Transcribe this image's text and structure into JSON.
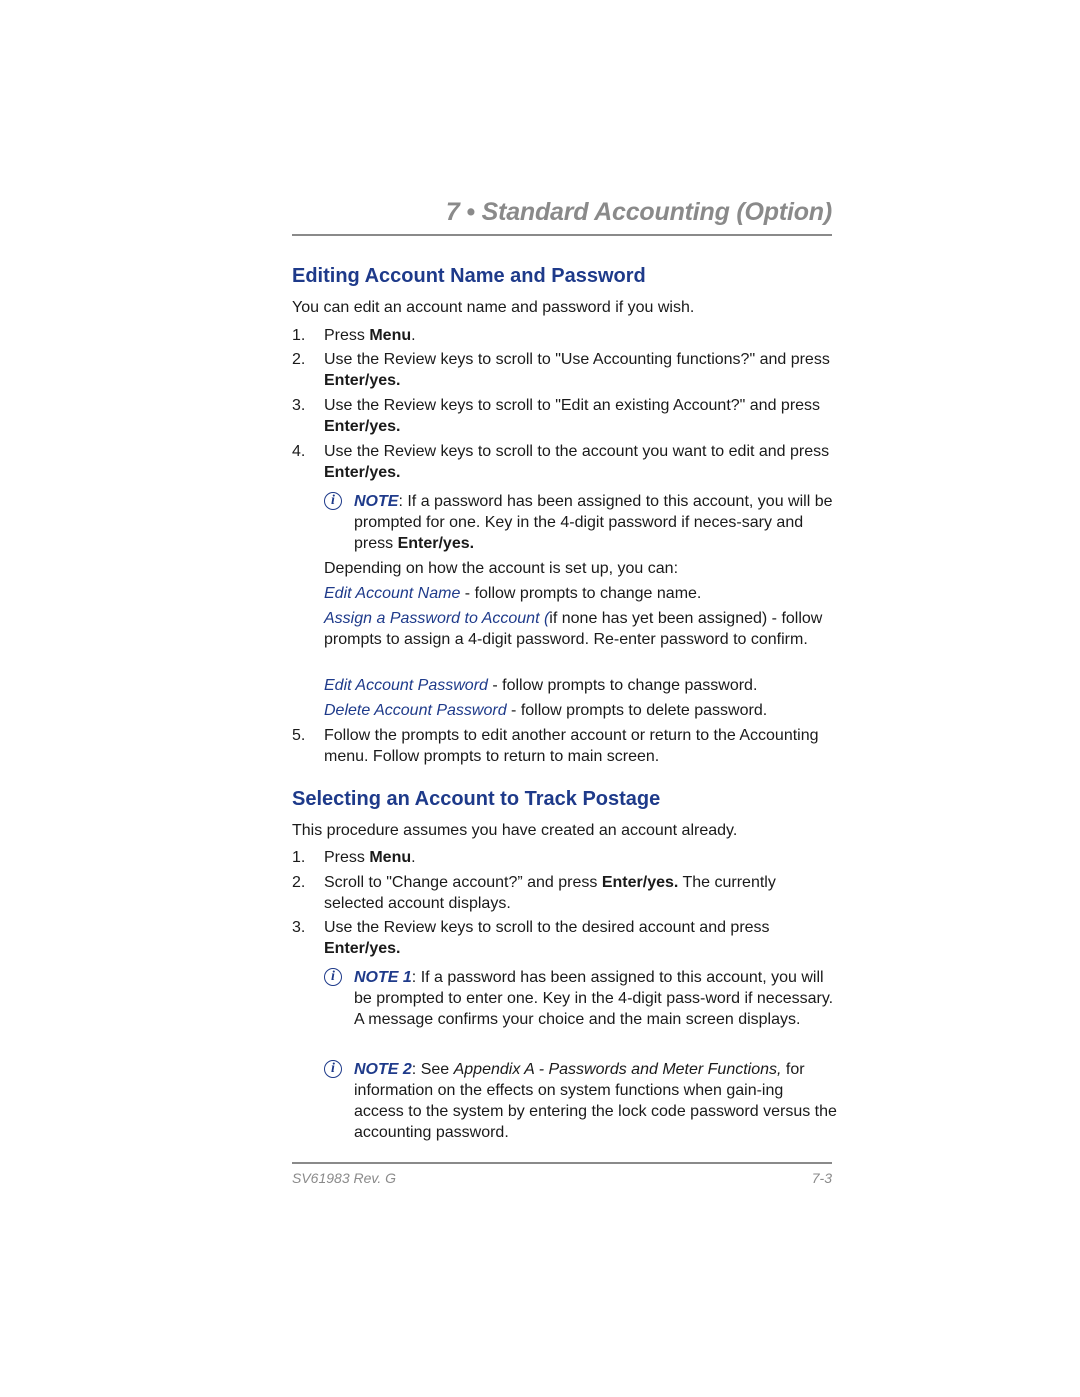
{
  "header": {
    "chapter_title": "7 • Standard Accounting (Option)"
  },
  "section1": {
    "heading": "Editing Account Name and Password",
    "intro": "You can edit an account name and password if you wish.",
    "steps": [
      {
        "num": "1.",
        "pre": "Press ",
        "bold": "Menu",
        "post": "."
      },
      {
        "num": "2.",
        "pre": "Use the Review keys to scroll to \"Use Accounting functions?\" and press ",
        "bold": "Enter/yes.",
        "post": ""
      },
      {
        "num": "3.",
        "pre": "Use the Review keys to scroll to \"Edit an existing Account?\" and press ",
        "bold": "Enter/yes.",
        "post": ""
      },
      {
        "num": "4.",
        "pre": "Use the Review keys to scroll to the account you want to edit and press ",
        "bold": "Enter/yes.",
        "post": ""
      },
      {
        "num": "5.",
        "pre": "Follow the prompts to edit another account or return to the Accounting menu. Follow prompts to return to main screen.",
        "bold": "",
        "post": ""
      }
    ],
    "note": {
      "icon": "info-icon",
      "label": "NOTE",
      "colon": ":",
      "pre": "  If a password has been assigned to this account, you will be prompted for one. Key in the 4-digit password if neces-sary and press ",
      "bold": "Enter/yes.",
      "post": ""
    },
    "options_intro": "Depending on how the account is set up, you can:",
    "options": [
      {
        "link": "Edit Account Name",
        "text": " - follow prompts to change name."
      },
      {
        "link": "Assign a Password to Account (",
        "text": "if none has yet been assigned) - follow prompts to assign a 4-digit password. Re-enter password to confirm."
      },
      {
        "link": "Edit Account Password",
        "text": " - follow prompts to change password."
      },
      {
        "link": "Delete Account Password",
        "text": " - follow prompts to delete password."
      }
    ]
  },
  "section2": {
    "heading": "Selecting an Account to Track Postage",
    "intro": "This procedure assumes you have created an account already.",
    "steps": [
      {
        "num": "1.",
        "pre": "Press ",
        "bold": "Menu",
        "post": "."
      },
      {
        "num": "2.",
        "pre": "Scroll to \"Change account?” and press ",
        "bold": "Enter/yes.",
        "post": " The currently selected account displays."
      },
      {
        "num": "3.",
        "pre": "Use the Review keys to scroll to the desired account and press ",
        "bold": "Enter/yes.",
        "post": ""
      }
    ],
    "note1": {
      "icon": "info-icon",
      "label": "NOTE 1",
      "colon": ":",
      "text": "  If a password has been assigned to this account, you will be prompted to enter one. Key in the 4-digit pass-word if necessary. A message confirms your choice and the main screen displays."
    },
    "note2": {
      "icon": "info-icon",
      "label": "NOTE 2",
      "colon": ":",
      "pre": "  See ",
      "italic": "Appendix A - Passwords and Meter Functions,",
      "post": " for information on the effects on system functions when gain-ing access to the system by entering the lock code password versus the accounting password."
    }
  },
  "footer": {
    "doc_id": "SV61983 Rev. G",
    "page_number": "7-3"
  }
}
